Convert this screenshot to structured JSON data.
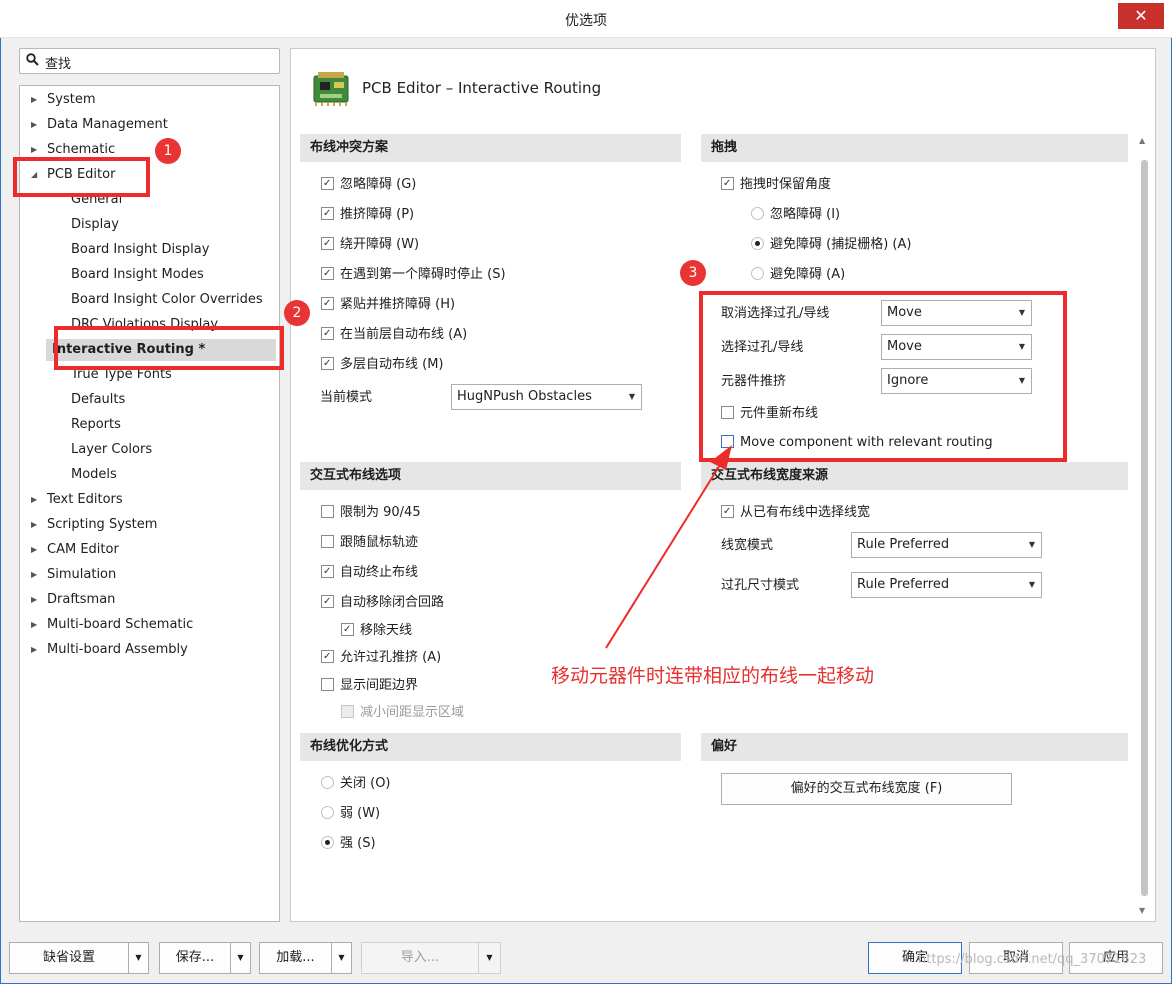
{
  "window": {
    "title": "优选项",
    "close_glyph": "✕"
  },
  "search": {
    "icon": "search-icon",
    "value": "查找"
  },
  "tree": {
    "items": [
      {
        "label": "System",
        "arrow": "▶"
      },
      {
        "label": "Data Management",
        "arrow": "▶"
      },
      {
        "label": "Schematic",
        "arrow": "▶"
      },
      {
        "label": "PCB Editor",
        "arrow": "◢"
      },
      {
        "label": "General"
      },
      {
        "label": "Display"
      },
      {
        "label": "Board Insight Display"
      },
      {
        "label": "Board Insight Modes"
      },
      {
        "label": "Board Insight Color Overrides"
      },
      {
        "label": "DRC Violations Display"
      },
      {
        "label": "Interactive Routing *"
      },
      {
        "label": "True Type Fonts"
      },
      {
        "label": "Defaults"
      },
      {
        "label": "Reports"
      },
      {
        "label": "Layer Colors"
      },
      {
        "label": "Models"
      },
      {
        "label": "Text Editors",
        "arrow": "▶"
      },
      {
        "label": "Scripting System",
        "arrow": "▶"
      },
      {
        "label": "CAM Editor",
        "arrow": "▶"
      },
      {
        "label": "Simulation",
        "arrow": "▶"
      },
      {
        "label": "Draftsman",
        "arrow": "▶"
      },
      {
        "label": "Multi-board Schematic",
        "arrow": "▶"
      },
      {
        "label": "Multi-board Assembly",
        "arrow": "▶"
      }
    ]
  },
  "page": {
    "heading": "PCB Editor – Interactive Routing"
  },
  "conflict": {
    "title": "布线冲突方案",
    "options": [
      {
        "label": "忽略障碍 (G)",
        "checked": true
      },
      {
        "label": "推挤障碍 (P)",
        "checked": true
      },
      {
        "label": "绕开障碍 (W)",
        "checked": true
      },
      {
        "label": "在遇到第一个障碍时停止 (S)",
        "checked": true
      },
      {
        "label": "紧贴并推挤障碍 (H)",
        "checked": true
      },
      {
        "label": "在当前层自动布线 (A)",
        "checked": true
      },
      {
        "label": "多层自动布线 (M)",
        "checked": true
      }
    ],
    "mode_label": "当前模式",
    "mode_value": "HugNPush Obstacles"
  },
  "drag": {
    "title": "拖拽",
    "keep_angle": "拖拽时保留角度",
    "radios": [
      {
        "label": "忽略障碍 (I)",
        "on": false
      },
      {
        "label": "避免障碍 (捕捉栅格) (A)",
        "on": true
      },
      {
        "label": "避免障碍 (A)",
        "on": false
      }
    ],
    "rows": [
      {
        "label": "取消选择过孔/导线",
        "value": "Move"
      },
      {
        "label": "选择过孔/导线",
        "value": "Move"
      },
      {
        "label": "元器件推挤",
        "value": "Ignore"
      }
    ],
    "reroute": "元件重新布线",
    "move_with_routing": "Move component with relevant routing"
  },
  "options": {
    "title": "交互式布线选项",
    "items": [
      {
        "label": "限制为 90/45",
        "checked": false
      },
      {
        "label": "跟随鼠标轨迹",
        "checked": false
      },
      {
        "label": "自动终止布线",
        "checked": true
      },
      {
        "label": "自动移除闭合回路",
        "checked": true
      },
      {
        "label": "移除天线",
        "checked": true
      },
      {
        "label": "允许过孔推挤 (A)",
        "checked": true
      },
      {
        "label": "显示间距边界",
        "checked": false
      },
      {
        "label": "减小间距显示区域",
        "checked": false
      }
    ]
  },
  "width_source": {
    "title": "交互式布线宽度来源",
    "pick_existing": "从已有布线中选择线宽",
    "width_mode_label": "线宽模式",
    "width_mode_value": "Rule Preferred",
    "via_mode_label": "过孔尺寸模式",
    "via_mode_value": "Rule Preferred"
  },
  "optimize": {
    "title": "布线优化方式",
    "radios": [
      {
        "label": "关闭 (O)",
        "on": false
      },
      {
        "label": "弱 (W)",
        "on": false
      },
      {
        "label": "强 (S)",
        "on": true
      }
    ]
  },
  "preference": {
    "title": "偏好",
    "button": "偏好的交互式布线宽度 (F)"
  },
  "bottom": {
    "defaults": "缺省设置",
    "save": "保存...",
    "load": "加载...",
    "import": "导入...",
    "ok": "确定",
    "cancel": "取消",
    "apply": "应用"
  },
  "annotations": {
    "badges": [
      "1",
      "2",
      "3"
    ],
    "note": "移动元器件时连带相应的布线一起移动",
    "color": "#ee2b2b"
  },
  "watermark": "https://blog.csdn.net/qq_37071623"
}
